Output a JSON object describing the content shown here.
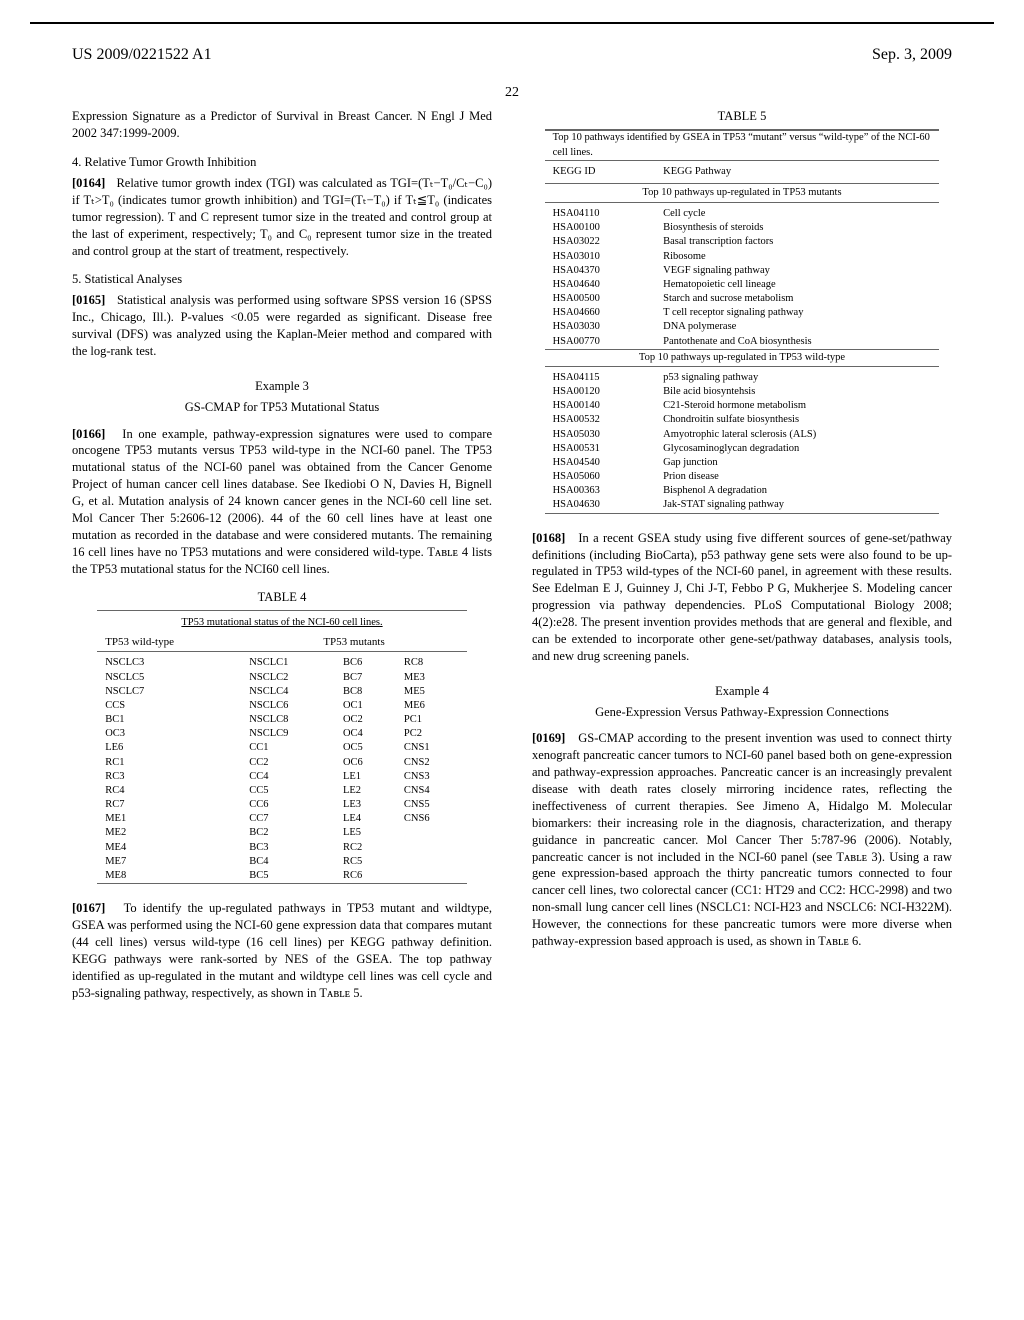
{
  "header": {
    "patent_number": "US 2009/0221522 A1",
    "date": "Sep. 3, 2009",
    "page": "22"
  },
  "col_left": {
    "intro_tail": "Expression Signature as a Predictor of Survival in Breast Cancer. N Engl J Med 2002 347:1999-2009.",
    "sec4_title": "4. Relative Tumor Growth Inhibition",
    "p0164_num": "[0164]",
    "p0164": "Relative tumor growth index (TGI) was calculated as TGI=(Tₜ−T₀/Cₜ−C₀) if Tₜ>T₀ (indicates tumor growth inhibition) and TGI=(Tₜ−T₀) if Tₜ≦T₀ (indicates tumor regression). T and C represent tumor size in the treated and control group at the last of experiment, respectively; T₀ and C₀ represent tumor size in the treated and control group at the start of treatment, respectively.",
    "sec5_title": "5. Statistical Analyses",
    "p0165_num": "[0165]",
    "p0165": "Statistical analysis was performed using software SPSS version 16 (SPSS Inc., Chicago, Ill.). P-values <0.05 were regarded as significant. Disease free survival (DFS) was analyzed using the Kaplan-Meier method and compared with the log-rank test.",
    "ex3_label": "Example 3",
    "ex3_title": "GS-CMAP for TP53 Mutational Status",
    "p0166_num": "[0166]",
    "p0166": "In one example, pathway-expression signatures were used to compare oncogene TP53 mutants versus TP53 wild-type in the NCI-60 panel. The TP53 mutational status of the NCI-60 panel was obtained from the Cancer Genome Project of human cancer cell lines database. See Ikediobi O N, Davies H, Bignell G, et al. Mutation analysis of 24 known cancer genes in the NCI-60 cell line set. Mol Cancer Ther 5:2606-12 (2006). 44 of the 60 cell lines have at least one mutation as recorded in the database and were considered mutants. The remaining 16 cell lines have no TP53 mutations and were considered wild-type. Tᴀʙʟᴇ 4 lists the TP53 mutational status for the NCI60 cell lines.",
    "table4_caption": "TABLE 4",
    "table4_subtitle": "TP53 mutational status of the NCI-60 cell lines.",
    "table4": {
      "h1": "TP53 wild-type",
      "h2": "TP53 mutants",
      "rows": [
        [
          "NSCLC3",
          "NSCLC1",
          "BC6",
          "RC8"
        ],
        [
          "NSCLC5",
          "NSCLC2",
          "BC7",
          "ME3"
        ],
        [
          "NSCLC7",
          "NSCLC4",
          "BC8",
          "ME5"
        ],
        [
          "CCS",
          "NSCLC6",
          "OC1",
          "ME6"
        ],
        [
          "BC1",
          "NSCLC8",
          "OC2",
          "PC1"
        ],
        [
          "OC3",
          "NSCLC9",
          "OC4",
          "PC2"
        ],
        [
          "LE6",
          "CC1",
          "OC5",
          "CNS1"
        ],
        [
          "RC1",
          "CC2",
          "OC6",
          "CNS2"
        ],
        [
          "RC3",
          "CC4",
          "LE1",
          "CNS3"
        ],
        [
          "RC4",
          "CC5",
          "LE2",
          "CNS4"
        ],
        [
          "RC7",
          "CC6",
          "LE3",
          "CNS5"
        ],
        [
          "ME1",
          "CC7",
          "LE4",
          "CNS6"
        ],
        [
          "ME2",
          "BC2",
          "LE5",
          ""
        ],
        [
          "ME4",
          "BC3",
          "RC2",
          ""
        ],
        [
          "ME7",
          "BC4",
          "RC5",
          ""
        ],
        [
          "ME8",
          "BC5",
          "RC6",
          ""
        ]
      ]
    },
    "p0167_num": "[0167]",
    "p0167": "To identify the up-regulated pathways in TP53 mutant and wildtype, GSEA was performed using the NCI-60 gene expression data that compares mutant (44 cell lines) versus wild-type (16 cell lines) per KEGG pathway definition. KEGG pathways were rank-sorted by NES of the GSEA. The top pathway identified as up-regulated in the mutant and wildtype cell lines was cell cycle and p53-signaling pathway, respectively, as shown in Tᴀʙʟᴇ 5."
  },
  "col_right": {
    "table5_caption": "TABLE 5",
    "table5_title": "Top 10 pathways identified by GSEA in TP53 “mutant” versus “wild-type” of the NCI-60 cell lines.",
    "table5_head1": "KEGG ID",
    "table5_head2": "KEGG Pathway",
    "table5_sub_mut": "Top 10 pathways up-regulated in TP53 mutants",
    "table5_mut": [
      [
        "HSA04110",
        "Cell cycle"
      ],
      [
        "HSA00100",
        "Biosynthesis of steroids"
      ],
      [
        "HSA03022",
        "Basal transcription factors"
      ],
      [
        "HSA03010",
        "Ribosome"
      ],
      [
        "HSA04370",
        "VEGF signaling pathway"
      ],
      [
        "HSA04640",
        "Hematopoietic cell lineage"
      ],
      [
        "HSA00500",
        "Starch and sucrose metabolism"
      ],
      [
        "HSA04660",
        "T cell receptor signaling pathway"
      ],
      [
        "HSA03030",
        "DNA polymerase"
      ],
      [
        "HSA00770",
        "Pantothenate and CoA biosynthesis"
      ]
    ],
    "table5_sub_wt": "Top 10 pathways up-regulated in TP53 wild-type",
    "table5_wt": [
      [
        "HSA04115",
        "p53 signaling pathway"
      ],
      [
        "HSA00120",
        "Bile acid biosyntehsis"
      ],
      [
        "HSA00140",
        "C21-Steroid hormone metabolism"
      ],
      [
        "HSA00532",
        "Chondroitin sulfate biosynthesis"
      ],
      [
        "HSA05030",
        "Amyotrophic lateral sclerosis (ALS)"
      ],
      [
        "HSA00531",
        "Glycosaminoglycan degradation"
      ],
      [
        "HSA04540",
        "Gap junction"
      ],
      [
        "HSA05060",
        "Prion disease"
      ],
      [
        "HSA00363",
        "Bisphenol A degradation"
      ],
      [
        "HSA04630",
        "Jak-STAT signaling pathway"
      ]
    ],
    "p0168_num": "[0168]",
    "p0168": "In a recent GSEA study using five different sources of gene-set/pathway definitions (including BioCarta), p53 pathway gene sets were also found to be up-regulated in TP53 wild-types of the NCI-60 panel, in agreement with these results. See Edelman E J, Guinney J, Chi J-T, Febbo P G, Mukherjee S. Modeling cancer progression via pathway dependencies. PLoS Computational Biology 2008; 4(2):e28. The present invention provides methods that are general and flexible, and can be extended to incorporate other gene-set/pathway databases, analysis tools, and new drug screening panels.",
    "ex4_label": "Example 4",
    "ex4_title": "Gene-Expression Versus Pathway-Expression Connections",
    "p0169_num": "[0169]",
    "p0169": "GS-CMAP according to the present invention was used to connect thirty xenograft pancreatic cancer tumors to NCI-60 panel based both on gene-expression and pathway-expression approaches. Pancreatic cancer is an increasingly prevalent disease with death rates closely mirroring incidence rates, reflecting the ineffectiveness of current therapies. See Jimeno A, Hidalgo M. Molecular biomarkers: their increasing role in the diagnosis, characterization, and therapy guidance in pancreatic cancer. Mol Cancer Ther 5:787-96 (2006). Notably, pancreatic cancer is not included in the NCI-60 panel (see Tᴀʙʟᴇ 3). Using a raw gene expression-based approach the thirty pancreatic tumors connected to four cancer cell lines, two colorectal cancer (CC1: HT29 and CC2: HCC-2998) and two non-small lung cancer cell lines (NSCLC1: NCI-H23 and NSCLC6: NCI-H322M). However, the connections for these pancreatic tumors were more diverse when pathway-expression based approach is used, as shown in Tᴀʙʟᴇ 6."
  }
}
